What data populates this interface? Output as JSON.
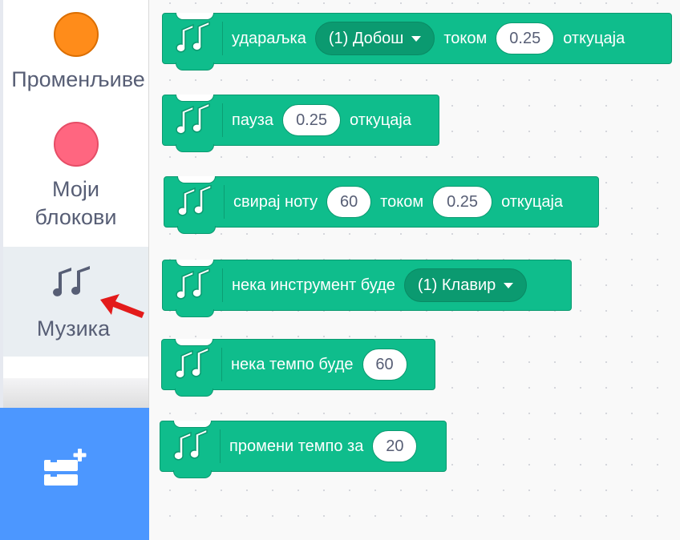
{
  "categories": [
    {
      "id": "variables",
      "label": "Променљиве",
      "color": "#ff8c1a"
    },
    {
      "id": "myblocks",
      "label_line1": "Моји",
      "label_line2": "блокови",
      "color": "#ff6680"
    },
    {
      "id": "music",
      "label": "Музика",
      "icon": "music-notes-icon",
      "selected": true
    }
  ],
  "extension_button": {
    "icon": "add-extension-icon"
  },
  "blocks": [
    {
      "id": "play-drum",
      "text1": "удараљка",
      "dropdown": "(1) Добош",
      "text2": "током",
      "input": "0.25",
      "text3": "откуцаја"
    },
    {
      "id": "rest",
      "text1": "пауза",
      "input": "0.25",
      "text2": "откуцаја"
    },
    {
      "id": "play-note",
      "text1": "свирај ноту",
      "input1": "60",
      "text2": "током",
      "input2": "0.25",
      "text3": "откуцаја"
    },
    {
      "id": "set-instrument",
      "text1": "нека инструмент буде",
      "dropdown": "(1) Клавир"
    },
    {
      "id": "set-tempo",
      "text1": "нека темпо буде",
      "input": "60"
    },
    {
      "id": "change-tempo",
      "text1": "промени темпо за",
      "input": "20"
    }
  ],
  "colors": {
    "music_block": "#0fbd8c",
    "music_block_border": "#0b9a70",
    "extension": "#4c97ff",
    "arrow": "#e31b1b"
  }
}
